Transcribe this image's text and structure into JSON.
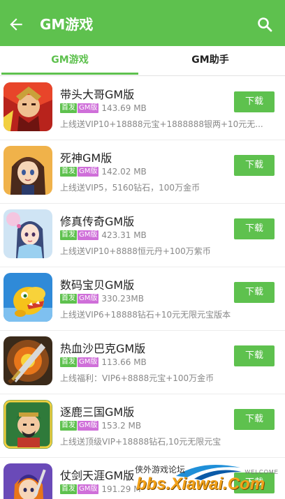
{
  "app": {
    "title": "GM游戏",
    "back_icon": "arrow-back-icon",
    "search_icon": "search-icon",
    "accent_color": "#5ec14e",
    "gm_badge_color": "#cf6fd9"
  },
  "tabs": [
    {
      "label": "GM游戏",
      "active": true
    },
    {
      "label": "GM助手",
      "active": false
    }
  ],
  "games": [
    {
      "name": "带头大哥GM版",
      "badge_first": "首发",
      "badge_gm": "GM版",
      "size": "143.69 MB",
      "desc": "上线送VIP10+18888元宝+1888888银两+10元无...",
      "button": "下载",
      "icon": "warrior-red-icon"
    },
    {
      "name": "死神GM版",
      "badge_first": "首发",
      "badge_gm": "GM版",
      "size": "142.02 MB",
      "desc": "上线送VIP5，5160钻石，100万金币",
      "button": "下载",
      "icon": "anime-girl-icon"
    },
    {
      "name": "修真传奇GM版",
      "badge_first": "首发",
      "badge_gm": "GM版",
      "size": "423.31 MB",
      "desc": "上线送VIP10+8888恒元丹+100万紫币",
      "button": "下载",
      "icon": "fairy-girl-icon"
    },
    {
      "name": "数码宝贝GM版",
      "badge_first": "首发",
      "badge_gm": "GM版",
      "size": "330.23MB",
      "desc": "上线送VIP6+18888钻石+10元无限元宝版本",
      "button": "下载",
      "icon": "yellow-dinosaur-icon"
    },
    {
      "name": "热血沙巴克GM版",
      "badge_first": "首发",
      "badge_gm": "GM版",
      "size": "113.66 MB",
      "desc": "上线福利：VIP6+8888元宝+100万金币",
      "button": "下载",
      "icon": "flaming-sword-icon"
    },
    {
      "name": "逐鹿三国GM版",
      "badge_first": "首发",
      "badge_gm": "GM版",
      "size": "153.2 MB",
      "desc": "上线送顶级VIP+18888钻石,10元无限元宝",
      "button": "下载",
      "icon": "three-kingdoms-warrior-icon"
    },
    {
      "name": "仗剑天涯GM版",
      "badge_first": "首发",
      "badge_gm": "GM版",
      "size": "191.29 M",
      "desc": "",
      "button": "下载",
      "icon": "swordsman-icon"
    }
  ],
  "watermark": {
    "site_name": "侠外游戏论坛",
    "welcome": "WELCOME",
    "url": "bbs.Xiawai.Com"
  }
}
